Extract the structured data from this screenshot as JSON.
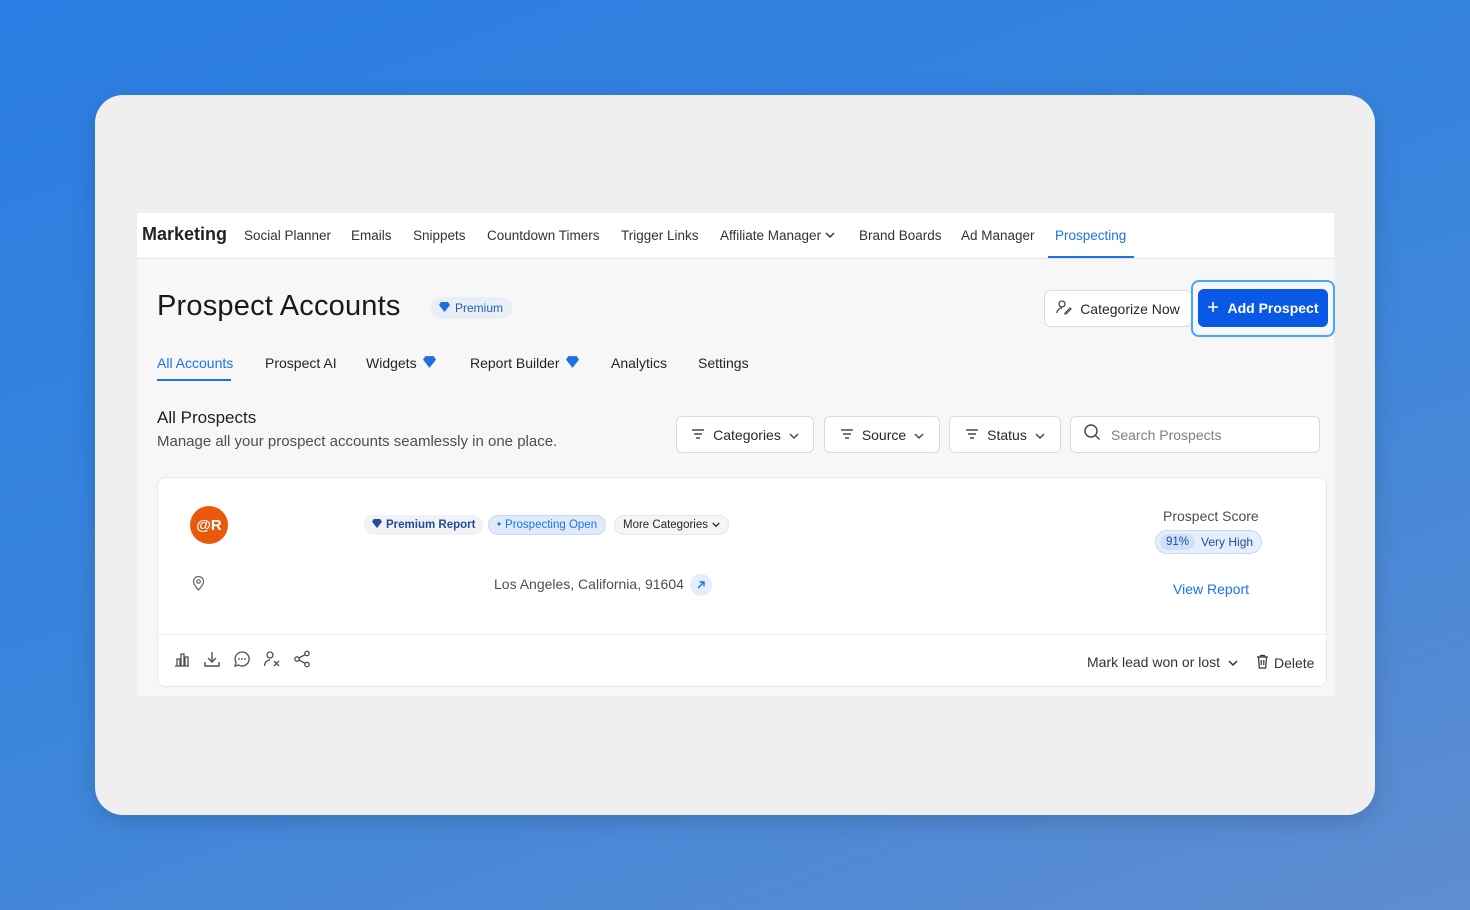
{
  "nav": {
    "brand": "Marketing",
    "items": [
      {
        "label": "Social Planner"
      },
      {
        "label": "Emails"
      },
      {
        "label": "Snippets"
      },
      {
        "label": "Countdown Timers"
      },
      {
        "label": "Trigger Links"
      },
      {
        "label": "Affiliate Manager",
        "has_dropdown": true
      },
      {
        "label": "Brand Boards"
      },
      {
        "label": "Ad Manager"
      },
      {
        "label": "Prospecting",
        "active": true
      }
    ]
  },
  "header": {
    "title": "Prospect Accounts",
    "premium_badge": "Premium",
    "categorize_label": "Categorize Now",
    "add_label": "Add Prospect"
  },
  "tabs": [
    {
      "label": "All Accounts",
      "active": true
    },
    {
      "label": "Prospect AI"
    },
    {
      "label": "Widgets",
      "premium": true
    },
    {
      "label": "Report Builder",
      "premium": true
    },
    {
      "label": "Analytics"
    },
    {
      "label": "Settings"
    }
  ],
  "section": {
    "title": "All Prospects",
    "subtitle": "Manage all your prospect accounts seamlessly in one place."
  },
  "filters": {
    "categories": "Categories",
    "source": "Source",
    "status": "Status",
    "search_placeholder": "Search Prospects"
  },
  "prospect": {
    "avatar_text": "@R",
    "avatar_color": "#e8590c",
    "chips": {
      "premium_report": "Premium Report",
      "prospecting_open": "Prospecting Open",
      "more_categories": "More Categories"
    },
    "location": "Los Angeles, California, 91604",
    "score_label": "Prospect Score",
    "score_value": "91%",
    "score_level": "Very High",
    "view_report": "View Report",
    "mark_lead": "Mark lead won or lost",
    "delete": "Delete"
  },
  "colors": {
    "accent": "#1a73e8",
    "primary_button": "#0a58e6",
    "avatar": "#e8590c"
  }
}
